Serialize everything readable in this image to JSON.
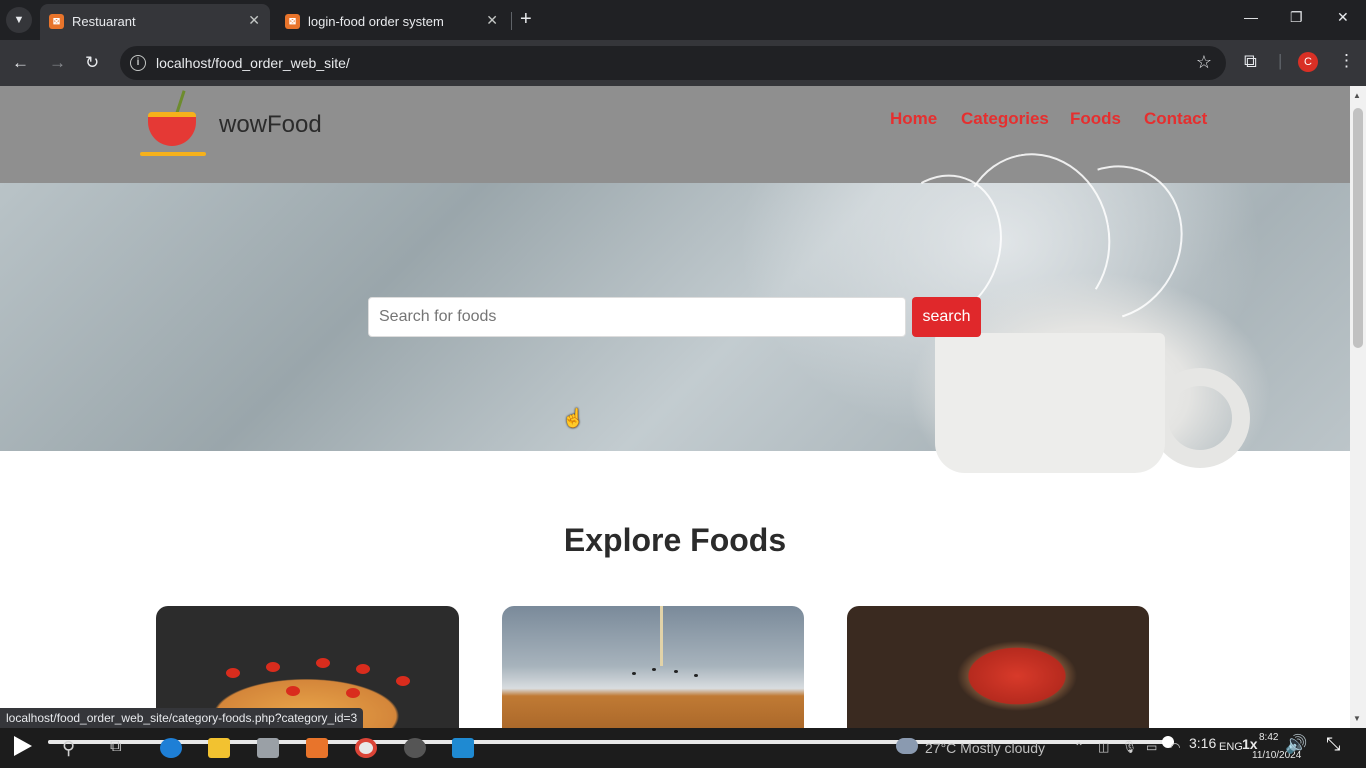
{
  "browser": {
    "tabs": [
      {
        "title": "Restuarant",
        "active": true
      },
      {
        "title": "login-food order system",
        "active": false
      }
    ],
    "address": "localhost/food_order_web_site/",
    "profile_initial": "C",
    "status_url": "localhost/food_order_web_site/category-foods.php?category_id=3"
  },
  "site": {
    "brand": "wowFood",
    "menu": [
      "Home",
      "Categories",
      "Foods",
      "Contact"
    ],
    "search": {
      "placeholder": "Search for foods",
      "button": "search"
    },
    "section_title": "Explore Foods",
    "cards": [
      "pizza",
      "burger",
      "soup"
    ],
    "accent_color": "#e0282b"
  },
  "player": {
    "progress": 0.995,
    "time": "3:16",
    "speed": "1x"
  },
  "taskbar": {
    "weather": "27°C  Mostly cloudy",
    "language": "ENG",
    "clock_time": "8:42",
    "clock_date": "11/10/2024"
  }
}
